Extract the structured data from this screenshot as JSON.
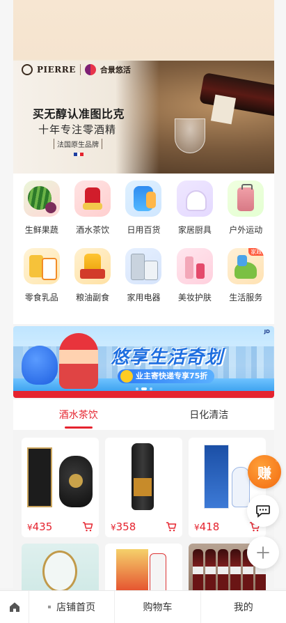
{
  "banner": {
    "brand_name_a": "PIERRE",
    "brand_name_b": "合景悠活",
    "headline": "买无醇认准图比克",
    "subline": "十年专注零酒精",
    "tag": "法国原生品牌",
    "flag_colors": [
      "#1e3fa0",
      "#ffffff",
      "#e5232e"
    ]
  },
  "categories": [
    {
      "label": "生鲜果蔬",
      "icon": "watermelon-icon"
    },
    {
      "label": "酒水茶饮",
      "icon": "liquor-icon"
    },
    {
      "label": "日用百货",
      "icon": "detergent-icon"
    },
    {
      "label": "家居厨具",
      "icon": "home-icon"
    },
    {
      "label": "户外运动",
      "icon": "luggage-icon"
    },
    {
      "label": "零食乳品",
      "icon": "snack-icon"
    },
    {
      "label": "粮油副食",
      "icon": "oil-icon"
    },
    {
      "label": "家用电器",
      "icon": "appliance-icon"
    },
    {
      "label": "美妆护肤",
      "icon": "cosmetics-icon"
    },
    {
      "label": "生活服务",
      "icon": "cleaning-icon",
      "badge": "家政"
    }
  ],
  "promo": {
    "title": "悠享生活奇划",
    "pill": "业主寄快递专享75折",
    "active_slide": 1,
    "slide_count": 3
  },
  "tabs": [
    {
      "label": "酒水茶饮",
      "active": true
    },
    {
      "label": "日化清洁",
      "active": false
    }
  ],
  "products": [
    {
      "currency": "¥",
      "price": "435"
    },
    {
      "currency": "¥",
      "price": "358"
    },
    {
      "currency": "¥",
      "price": "418"
    },
    {
      "currency": "",
      "price": ""
    },
    {
      "currency": "",
      "price": ""
    },
    {
      "currency": "",
      "price": ""
    }
  ],
  "floating": {
    "earn_label": "赚"
  },
  "bottom_nav": {
    "shop_home": "店铺首页",
    "cart": "购物车",
    "mine": "我的"
  },
  "colors": {
    "accent": "#e5232e",
    "earn": "#f26a0f"
  }
}
